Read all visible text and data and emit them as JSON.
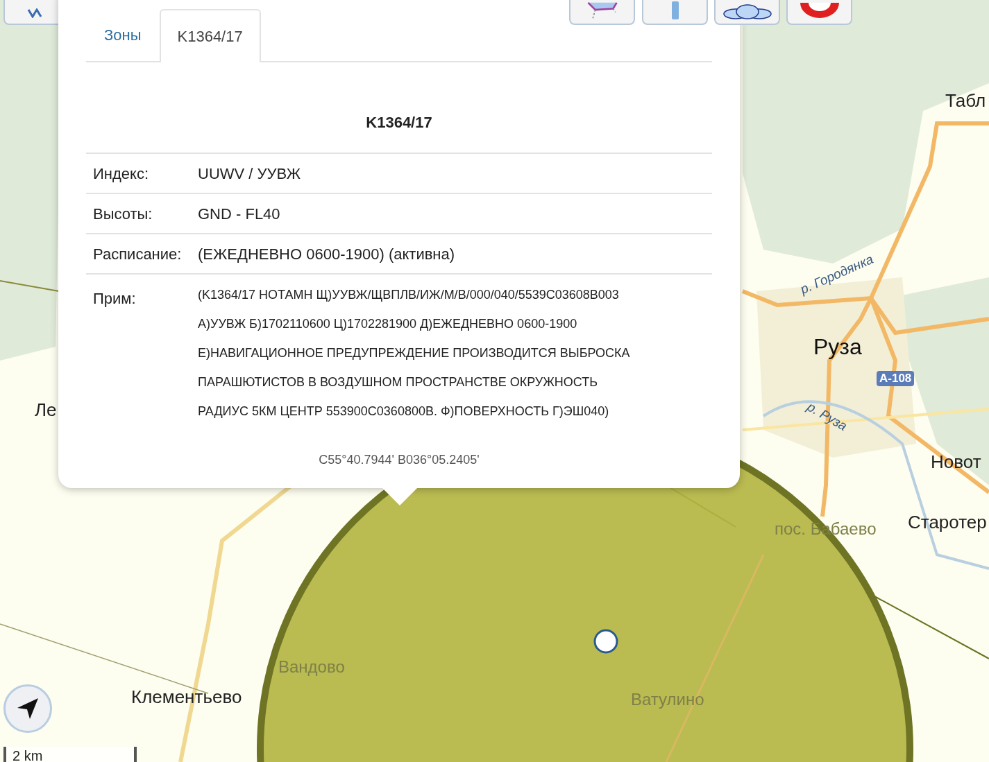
{
  "popup": {
    "tabs": [
      {
        "label": "Зоны",
        "selected": false
      },
      {
        "label": "K1364/17",
        "selected": true
      }
    ],
    "title": "K1364/17",
    "fields": [
      {
        "label": "Индекс:",
        "value": "UUWV / УУВЖ"
      },
      {
        "label": "Высоты:",
        "value": "GND - FL40"
      },
      {
        "label": "Расписание:",
        "value": "(ЕЖЕДНЕВНО 0600-1900) (активна)"
      }
    ],
    "note": {
      "label": "Прим:",
      "lines": [
        "(K1364/17 НОТАМН Щ)УУВЖ/ЩВПЛВ/ИЖ/М/В/000/040/5539С03608В003",
        "А)УУВЖ Б)1702110600 Ц)1702281900 Д)ЕЖЕДНЕВНО 0600-1900",
        "Е)НАВИГАЦИОННОЕ ПРЕДУПРЕЖДЕНИЕ ПРОИЗВОДИТСЯ ВЫБРОСКА",
        "ПАРАШЮТИСТОВ В ВОЗДУШНОМ ПРОСТРАНСТВЕ ОКРУЖНОСТЬ",
        "РАДИУС 5КМ ЦЕНТР 553900С0360800В. Ф)ПОВЕРХНОСТЬ Г)ЭШ040)"
      ]
    },
    "coordinates": "С55°40.7944' В036°05.2405'"
  },
  "map_labels": [
    {
      "text": "Табл",
      "kind": "place"
    },
    {
      "text": "р. Городянка",
      "kind": "river"
    },
    {
      "text": "Руза",
      "kind": "town"
    },
    {
      "text": "A-108",
      "kind": "road"
    },
    {
      "text": "р. Руза",
      "kind": "river"
    },
    {
      "text": "Новот",
      "kind": "place"
    },
    {
      "text": "Старотер",
      "kind": "place"
    },
    {
      "text": "пос. Бабаево",
      "kind": "faded"
    },
    {
      "text": "Ле",
      "kind": "place"
    },
    {
      "text": "Вандово",
      "kind": "faded"
    },
    {
      "text": "Клементьево",
      "kind": "place"
    },
    {
      "text": "Ватулино",
      "kind": "faded"
    }
  ],
  "scale": "2 km"
}
